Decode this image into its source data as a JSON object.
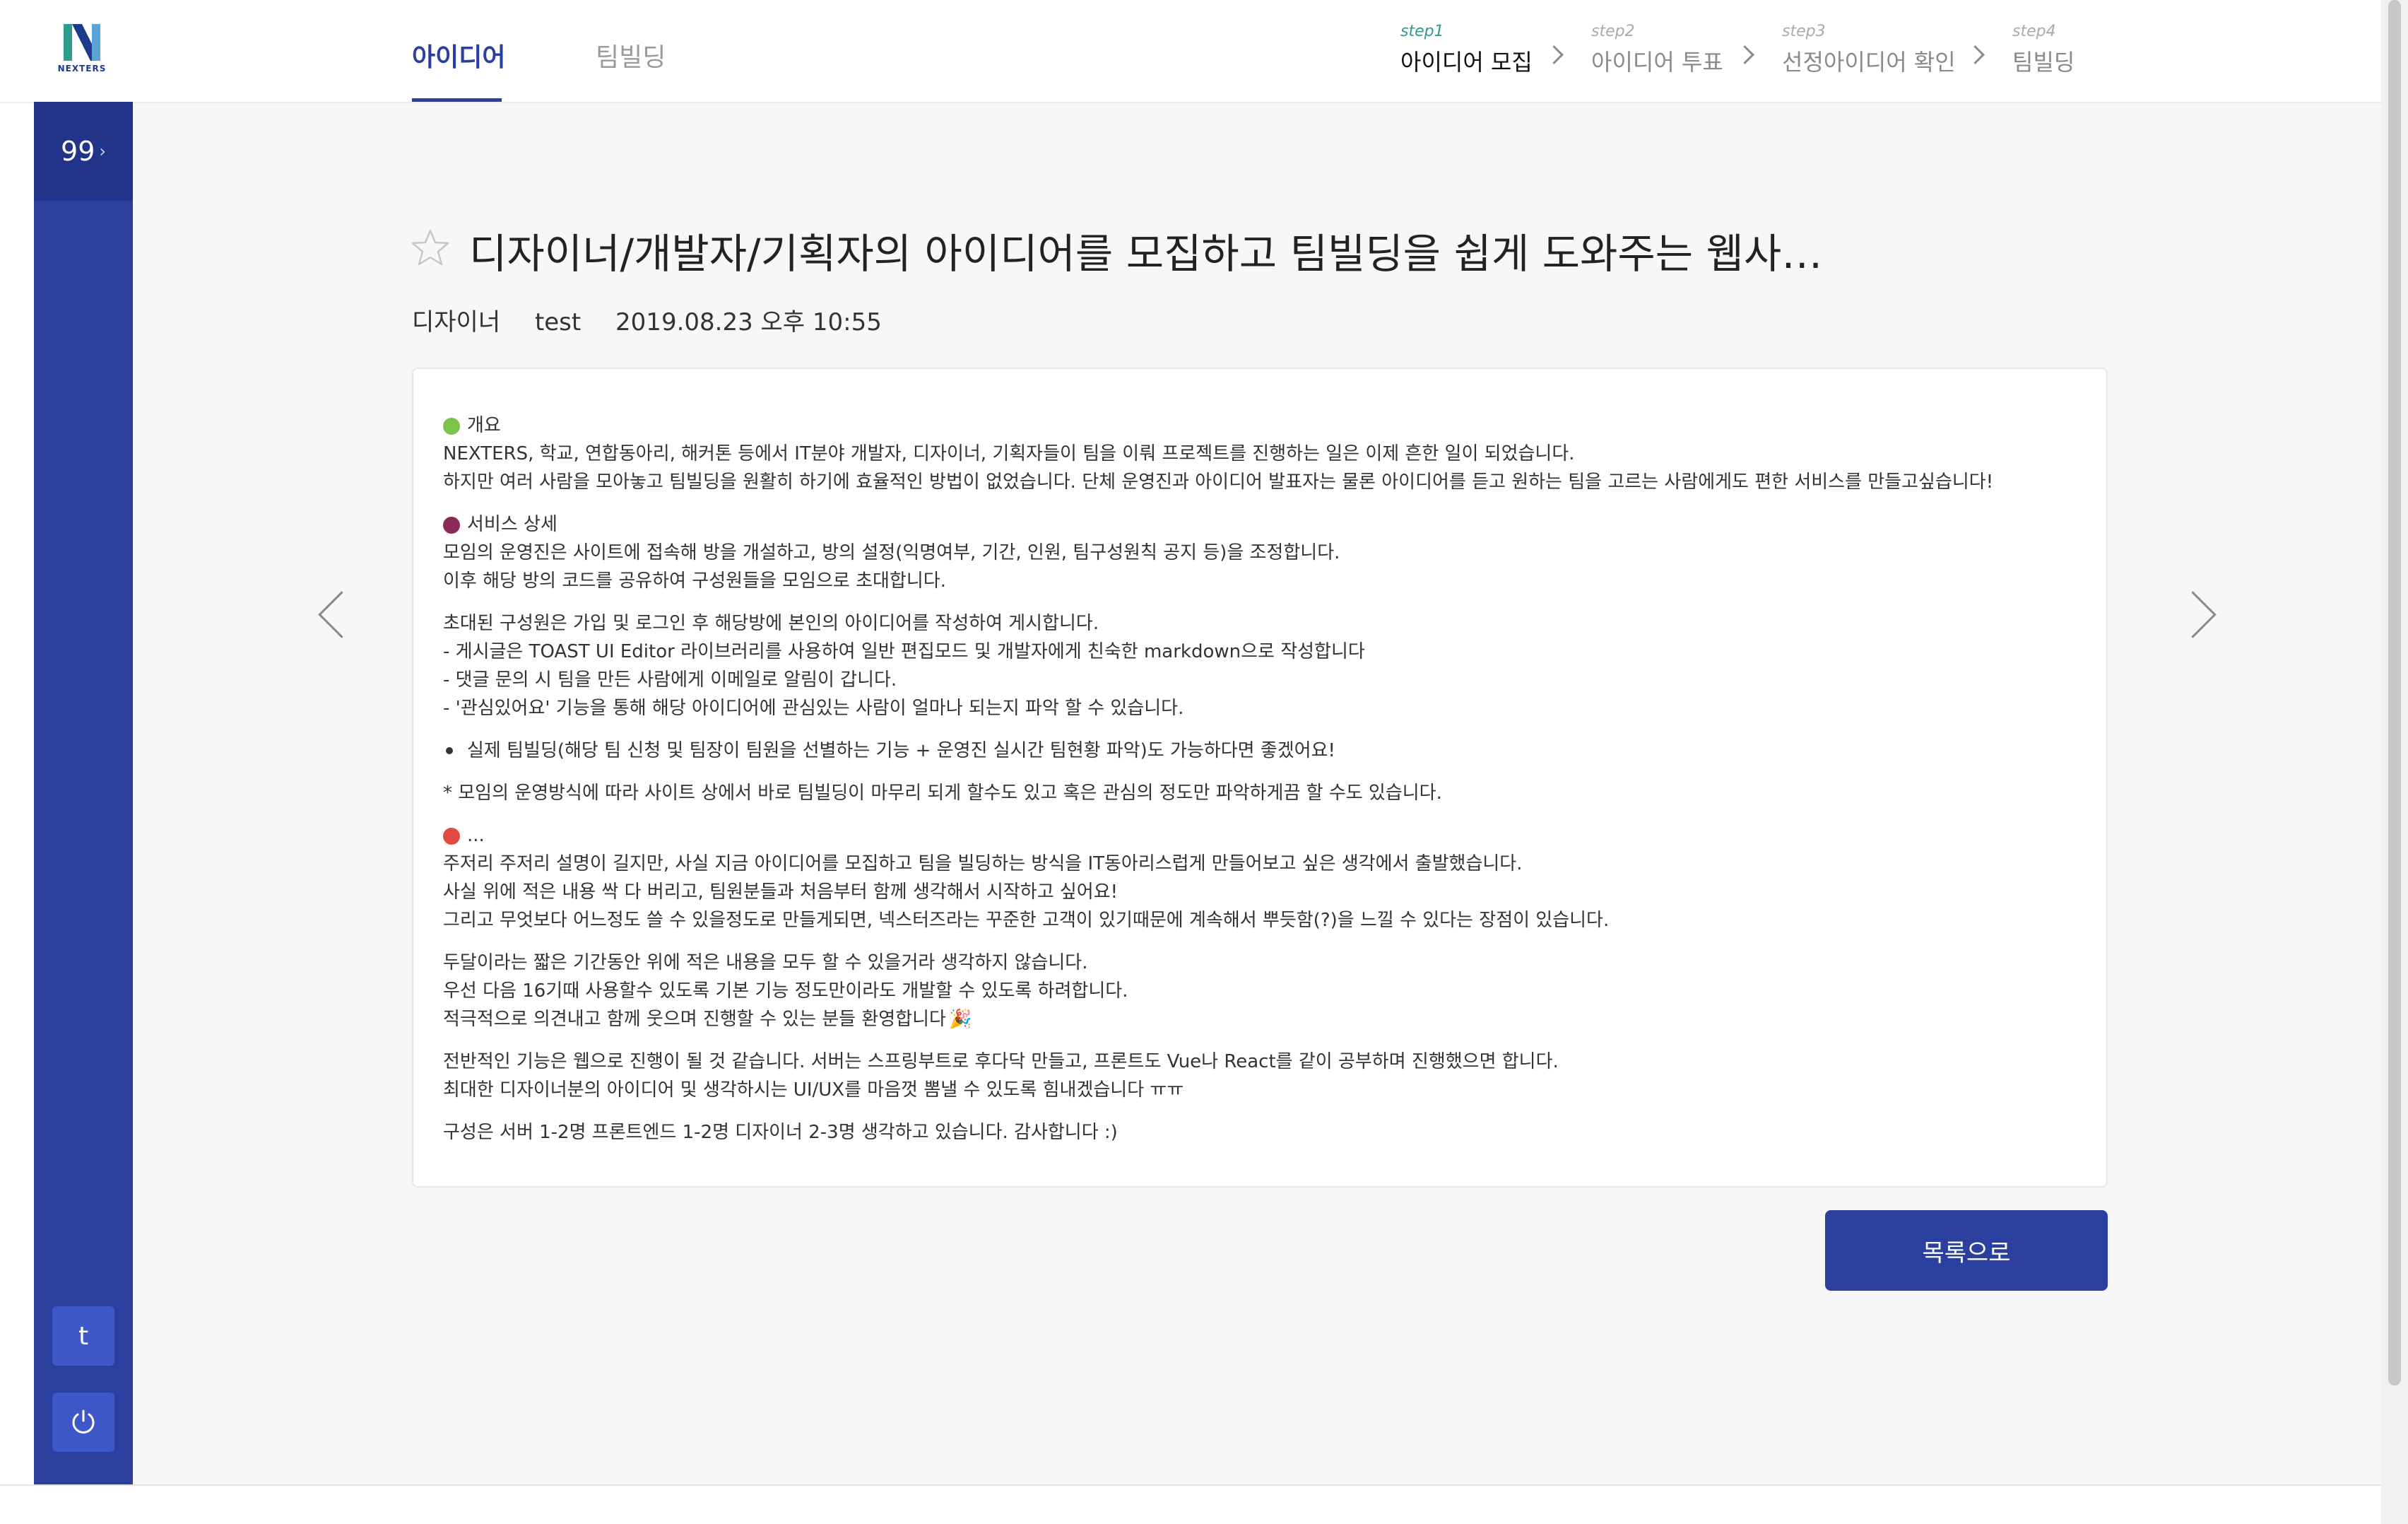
{
  "brand": {
    "name": "NEXTERS",
    "accent": "#2b3f9e",
    "sidebar_bg": "#2b3f9e",
    "step_active_color": "#2d9c8c"
  },
  "header": {
    "tabs": [
      {
        "label": "아이디어",
        "active": true
      },
      {
        "label": "팀빌딩",
        "active": false
      }
    ],
    "steps": [
      {
        "step": "step1",
        "name": "아이디어 모집",
        "active": true
      },
      {
        "step": "step2",
        "name": "아이디어 투표",
        "active": false
      },
      {
        "step": "step3",
        "name": "선정아이디어 확인",
        "active": false
      },
      {
        "step": "step4",
        "name": "팀빌딩",
        "active": false
      }
    ]
  },
  "sidebar": {
    "count": "99",
    "count_icon": "chevron-right-icon",
    "user_initial": "t",
    "power_icon": "power-icon"
  },
  "post": {
    "star_icon": "star-outline-icon",
    "title": "디자이너/개발자/기획자의 아이디어를 모집하고 팀빌딩을 쉽게 도와주는 웹사…",
    "role": "디자이너",
    "author": "test",
    "date": "2019.08.23 오후 10:55",
    "body": {
      "p1": {
        "icon": "green-apple-icon",
        "l1": "개요",
        "l2": "NEXTERS, 학교, 연합동아리, 해커톤 등에서 IT분야 개발자, 디자이너, 기획자들이 팀을 이뤄 프로젝트를 진행하는 일은 이제 흔한 일이 되었습니다.",
        "l3": "하지만 여러 사람을 모아놓고 팀빌딩을 원활히 하기에 효율적인 방법이 없었습니다. 단체 운영진과 아이디어 발표자는 물론 아이디어를 듣고 원하는 팀을 고르는 사람에게도 편한 서비스를 만들고싶습니다!"
      },
      "p2": {
        "icon": "grapes-icon",
        "l1": "서비스 상세",
        "l2": "모임의 운영진은 사이트에 접속해 방을 개설하고, 방의 설정(익명여부, 기간, 인원, 팀구성원칙 공지 등)을 조정합니다.",
        "l3": "이후 해당 방의 코드를 공유하여 구성원들을 모임으로 초대합니다."
      },
      "p3": {
        "l1": "초대된 구성원은 가입 및 로그인 후 해당방에 본인의 아이디어를 작성하여 게시합니다.",
        "l2": "- 게시글은 TOAST UI Editor 라이브러리를 사용하여 일반 편집모드 및 개발자에게 친숙한 markdown으로 작성합니다",
        "l3": "- 댓글 문의 시 팀을 만든 사람에게 이메일로 알림이 갑니다.",
        "l4": "- '관심있어요' 기능을 통해 해당 아이디어에 관심있는 사람이 얼마나 되는지 파악 할 수 있습니다."
      },
      "p4": "실제 팀빌딩(해당 팀 신청 및 팀장이 팀원을 선별하는 기능 + 운영진 실시간 팀현황 파악)도 가능하다면 좋겠어요!",
      "p5": "* 모임의 운영방식에 따라 사이트 상에서 바로 팀빌딩이 마무리 되게 할수도 있고 혹은 관심의 정도만 파악하게끔 할 수도 있습니다.",
      "p6": {
        "icon": "watermelon-icon",
        "l1": "...",
        "l2": "주저리 주저리 설명이 길지만, 사실 지금 아이디어를 모집하고 팀을 빌딩하는 방식을 IT동아리스럽게 만들어보고 싶은 생각에서 출발했습니다.",
        "l3": "사실 위에 적은 내용 싹 다 버리고, 팀원분들과 처음부터 함께 생각해서 시작하고 싶어요!",
        "l4": "그리고 무엇보다 어느정도 쓸 수 있을정도로 만들게되면, 넥스터즈라는 꾸준한 고객이 있기때문에 계속해서 뿌듯함(?)을 느낄 수 있다는 장점이 있습니다."
      },
      "p7": {
        "l1": "두달이라는 짧은 기간동안 위에 적은 내용을 모두 할 수 있을거라 생각하지 않습니다.",
        "l2": "우선 다음 16기때 사용할수 있도록 기본 기능 정도만이라도 개발할 수 있도록 하려합니다.",
        "l3": "적극적으로 의견내고 함께 웃으며 진행할 수 있는 분들 환영합니다",
        "l3_icon": "party-popper-icon"
      },
      "p8": {
        "l1": "전반적인 기능은 웹으로 진행이 될 것 같습니다. 서버는 스프링부트로 후다닥 만들고, 프론트도 Vue나 React를 같이 공부하며 진행했으면 합니다.",
        "l2": "최대한 디자이너분의 아이디어 및 생각하시는 UI/UX를 마음껏 뽐낼 수 있도록 힘내겠습니다 ㅠㅠ"
      },
      "p9": "구성은 서버 1-2명 프론트엔드 1-2명 디자이너 2-3명 생각하고 있습니다. 감사합니다 :)"
    },
    "prev_icon": "arrow-left-icon",
    "next_icon": "arrow-right-icon",
    "list_button": "목록으로"
  }
}
